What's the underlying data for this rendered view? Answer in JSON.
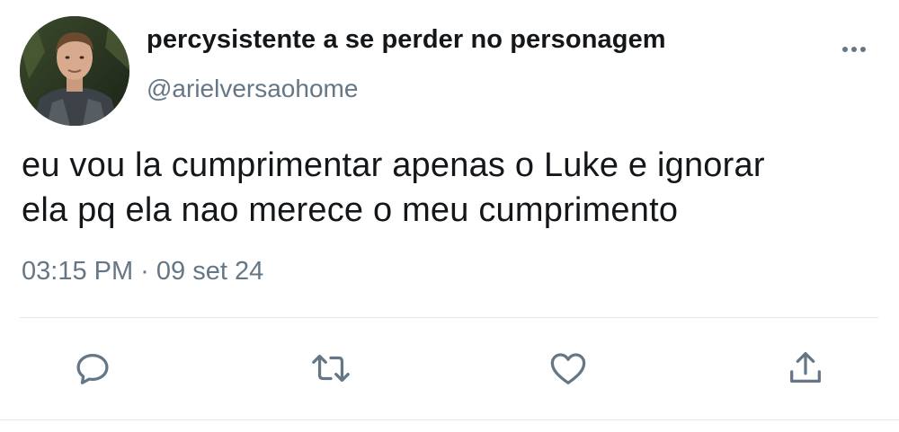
{
  "tweet": {
    "display_name": "percysistente a se perder no personagem",
    "handle": "@arielversaohome",
    "text_line1": "eu vou la cumprimentar apenas o Luke e ignorar",
    "text_line2": "ela pq ela nao merece o meu cumprimento",
    "timestamp": "03:15 PM · 09 set 24"
  },
  "actions": [
    {
      "icon": "reply-icon"
    },
    {
      "icon": "retweet-icon"
    },
    {
      "icon": "like-icon"
    },
    {
      "icon": "share-icon"
    }
  ],
  "colors": {
    "text": "#14171a",
    "secondary": "#657786",
    "divider": "#e1e8ed",
    "background": "#ffffff"
  }
}
